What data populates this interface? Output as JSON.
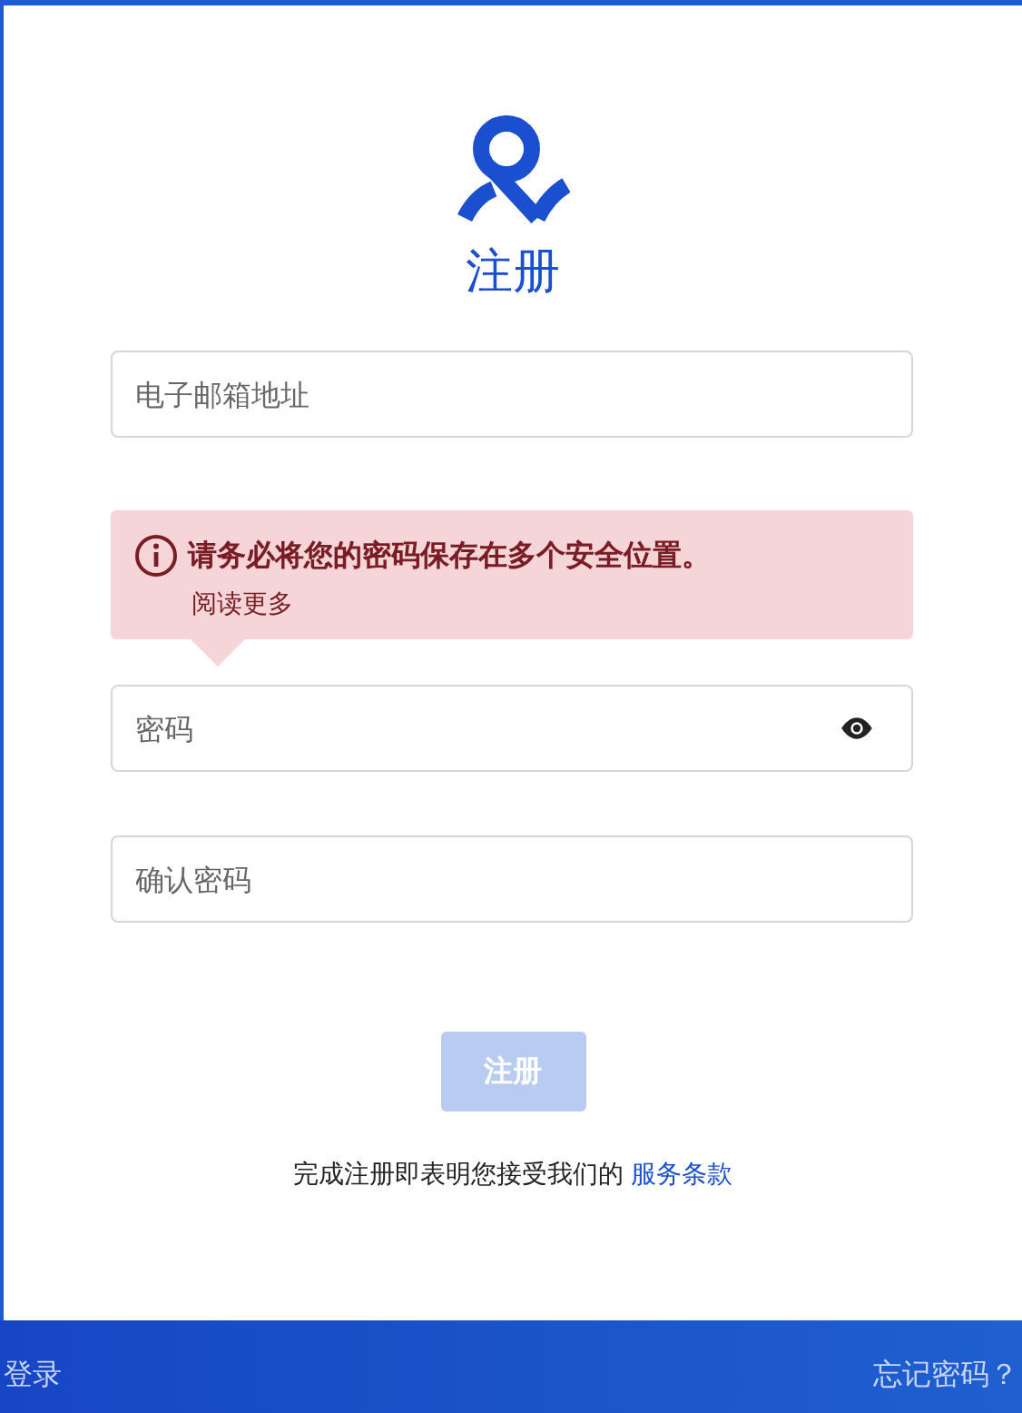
{
  "title": "注册",
  "email_field": {
    "placeholder": "电子邮箱地址"
  },
  "alert": {
    "message": "请务必将您的密码保存在多个安全位置。",
    "link": "阅读更多"
  },
  "password_field": {
    "placeholder": "密码"
  },
  "confirm_field": {
    "placeholder": "确认密码"
  },
  "submit_button": {
    "label": "注册",
    "disabled": true
  },
  "terms": {
    "text": "完成注册即表明您接受我们的",
    "link": "服务条款"
  },
  "footer": {
    "left_link": "登录",
    "right_link": "忘记密码？"
  }
}
